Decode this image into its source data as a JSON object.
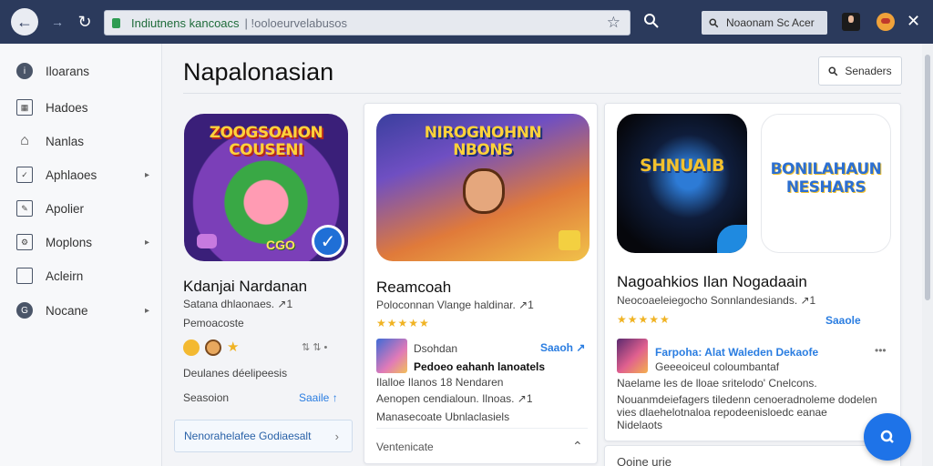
{
  "browser": {
    "url_host": "Indiutnens kancoacs",
    "url_path": "| !ooloeurvelabusos",
    "search_text": "Noaonam Sc Acer"
  },
  "sidebar": {
    "items": [
      {
        "label": "Iloarans",
        "icon": "info-icon"
      },
      {
        "label": "Hadoes",
        "icon": "grid-icon"
      },
      {
        "label": "Nanlas",
        "icon": "home-icon"
      },
      {
        "label": "Aphlaoes",
        "icon": "check-box-icon",
        "caret": "▸"
      },
      {
        "label": "Apolier",
        "icon": "edit-box-icon"
      },
      {
        "label": "Moplons",
        "icon": "gear-icon",
        "caret": "▸"
      },
      {
        "label": "Acleirn",
        "icon": "square-icon"
      },
      {
        "label": "Nocane",
        "icon": "g-circle-icon",
        "caret": "▸"
      }
    ]
  },
  "main": {
    "title": "Napalonasian",
    "top_button": "Senaders"
  },
  "cards": [
    {
      "thumb_text": "ZOOGSOAION COUSENI",
      "badge_text": "CGO",
      "title": "Kdanjai Nardanan",
      "line1": "Satana dhlaonaes. ↗︎1",
      "line2": "Pemoacoste",
      "line3": "Deulanes déelipeesis",
      "footer_left": "Seasoion",
      "footer_right": "Saaile ↑",
      "related": "Nenorahelafee Godiaesalt"
    },
    {
      "thumb_text": "NIROGNOHNN NBONS",
      "title": "Reamcoah",
      "line1": "Poloconnan Vlange haldinar. ↗︎1",
      "stars": "★★★★★",
      "sub_label": "Dsohdan",
      "sub_link": "Saaoh ↗",
      "sub_bold": "Pedoeo eahanh lanoatels",
      "sub_line": "Ilalloe Ilanos 18 Nendaren",
      "line2": "Aenopen cendialoun. Ilnoas. ↗︎1",
      "line3": "Manasecoate Ubnlaclasiels",
      "footer": "Ventenicate",
      "footer_caret": "⌃"
    },
    {
      "thumb1_text": "SHNUAIB",
      "thumb2_text": "BONILAHAUN NESHARS",
      "title": "Nagoahkios Ilan Nogadaain",
      "line1": "Neocoaeleiegocho Sonnlandesiands. ↗︎1",
      "stars": "★★★★★",
      "rating_link": "Saaole",
      "post_link": "Farpoha: Alat Waleden Dekaofe",
      "post_sub": "Geeeoiceul coloumbantaf",
      "post_menu": "•••",
      "body1": "Naelame les de lloae sritelodo' Cnelcons.",
      "body2": "Nouanmdeiefagers tiledenn cenoeradnoleme dodelen",
      "body3": "vies dlaehelotnaloa repodeenisloedc eanae",
      "body4": "Nidelaots",
      "bottom": "Ooine urie"
    }
  ],
  "colors": {
    "chrome": "#2b3a5c",
    "accent": "#2a7de1",
    "fab": "#1e73e8",
    "star": "#f0b323"
  }
}
